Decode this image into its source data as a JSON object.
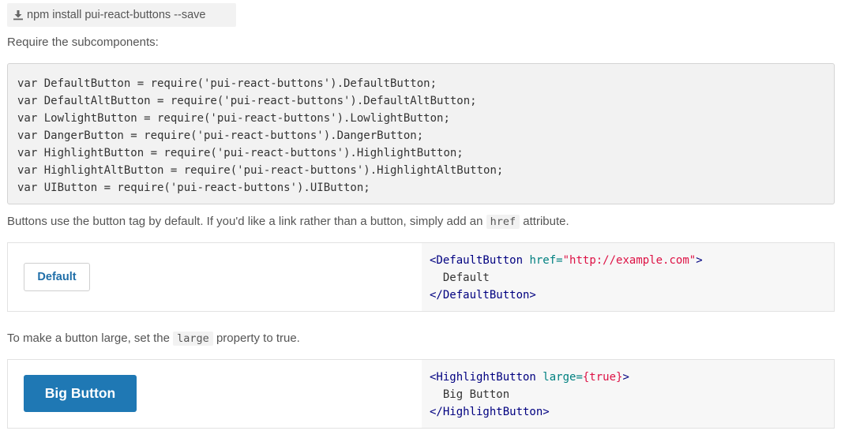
{
  "install": {
    "icon": "download-icon",
    "command": "npm install pui-react-buttons --save"
  },
  "intro": {
    "require_text": "Require the subcomponents:"
  },
  "require_code": [
    "var DefaultButton = require('pui-react-buttons').DefaultButton;",
    "var DefaultAltButton = require('pui-react-buttons').DefaultAltButton;",
    "var LowlightButton = require('pui-react-buttons').LowlightButton;",
    "var DangerButton = require('pui-react-buttons').DangerButton;",
    "var HighlightButton = require('pui-react-buttons').HighlightButton;",
    "var HighlightAltButton = require('pui-react-buttons').HighlightAltButton;",
    "var UIButton = require('pui-react-buttons').UIButton;"
  ],
  "link_note": {
    "before": "Buttons use the button tag by default. If you'd like a link rather than a button, simply add an",
    "code": "href",
    "after": "attribute."
  },
  "example_default": {
    "button_label": "Default",
    "code": {
      "open_tag": "<DefaultButton",
      "attr_name": "href=",
      "attr_value": "\"http://example.com\"",
      "open_close": ">",
      "content": "Default",
      "close_tag": "</DefaultButton>"
    }
  },
  "large_note": {
    "before": "To make a button large, set the",
    "code": "large",
    "after": "property to true."
  },
  "example_large": {
    "button_label": "Big Button",
    "code": {
      "open_tag": "<HighlightButton",
      "attr_name": "large=",
      "attr_value": "{true}",
      "open_close": ">",
      "content": "Big Button",
      "close_tag": "</HighlightButton>"
    }
  },
  "colors": {
    "primary": "#1f78b4",
    "link": "#1f6ea8",
    "code_bg": "#f2f2f2"
  }
}
